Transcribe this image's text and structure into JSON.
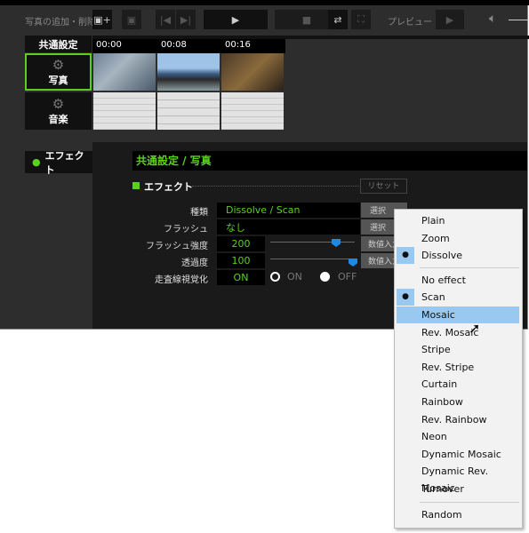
{
  "toolbar": {
    "add_remove_label": "写真の追加・削除",
    "play_icon": "play-icon",
    "stop_icon": "stop-icon",
    "preview_label": "プレビュー"
  },
  "left_panel": {
    "common_settings": "共通設定",
    "photo": "写真",
    "music": "音楽"
  },
  "timeline": {
    "times": [
      "00:00",
      "00:08",
      "00:16"
    ]
  },
  "sidebar": {
    "effect_tab": "エフェクト"
  },
  "main": {
    "header": "共通設定 / 写真",
    "section_title": "エフェクト",
    "reset": "リセット",
    "rows": [
      {
        "label": "種類",
        "value": "Dissolve / Scan",
        "button": "選択"
      },
      {
        "label": "フラッシュ",
        "value": "なし",
        "button": "選択"
      },
      {
        "label": "フラッシュ強度",
        "value": "200",
        "button": "数値入力",
        "slider_fraction": 0.8
      },
      {
        "label": "透過度",
        "value": "100",
        "button": "数値入力",
        "slider_fraction": 1.0
      },
      {
        "label": "走査線視覚化",
        "value": "ON",
        "opt_on": "ON",
        "opt_off": "OFF",
        "selected": "ON"
      }
    ]
  },
  "menu": {
    "group1": [
      "Plain",
      "Zoom",
      "Dissolve"
    ],
    "group2": [
      "No effect",
      "Scan",
      "Mosaic",
      "Rev. Mosaic",
      "Stripe",
      "Rev. Stripe",
      "Curtain",
      "Rainbow",
      "Rev. Rainbow",
      "Neon",
      "Dynamic Mosaic",
      "Dynamic Rev. Mosaic",
      "Turnover"
    ],
    "group3": [
      "Random"
    ],
    "checked": [
      "Dissolve",
      "Scan"
    ],
    "hovered": "Mosaic"
  },
  "colors": {
    "accent": "#5bd11a",
    "highlight": "#99c9f0"
  }
}
